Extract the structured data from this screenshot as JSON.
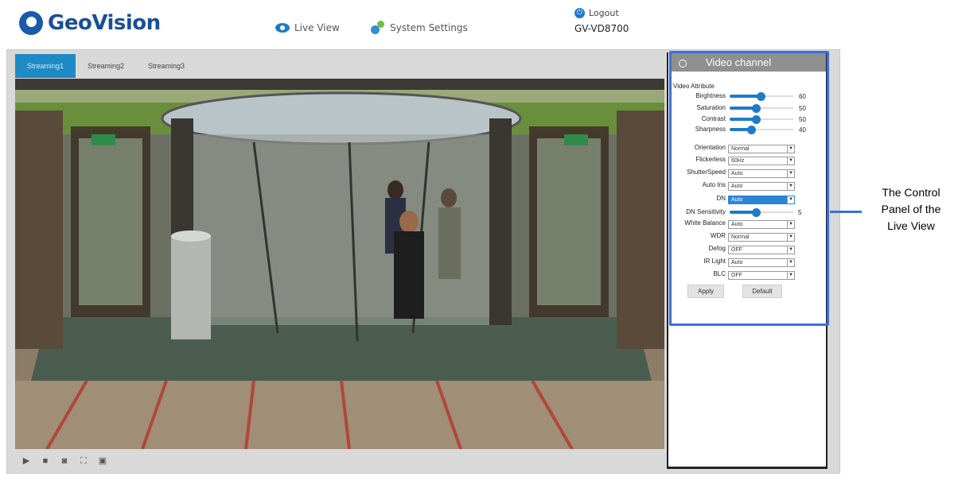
{
  "header": {
    "brand": "GeoVision",
    "nav_live_view": "Live View",
    "nav_system_settings": "System Settings",
    "logout": "Logout",
    "device_name": "GV-VD8700"
  },
  "tabs": [
    "Streaming1",
    "Streaming2",
    "Streaming3"
  ],
  "player_controls": [
    "play-icon",
    "stop-icon",
    "snapshot-icon",
    "fullscreen-icon",
    "record-icon"
  ],
  "panel": {
    "title": "Video channel",
    "attr_title": "Video Attribute",
    "sliders": [
      {
        "label": "Birghtness",
        "value": 60
      },
      {
        "label": "Saturation",
        "value": 50
      },
      {
        "label": "Contrast",
        "value": 50
      },
      {
        "label": "Sharpness",
        "value": 40
      }
    ],
    "selects": [
      {
        "label": "Orientation",
        "value": "Normal"
      },
      {
        "label": "Flickerless",
        "value": "60Hz"
      },
      {
        "label": "ShutterSpeed",
        "value": "Auto"
      },
      {
        "label": "Auto Iris",
        "value": "Auto"
      },
      {
        "label": "DN",
        "value": "Auto"
      }
    ],
    "dn_sensitivity": {
      "label": "DN Sensitivity",
      "value": 5
    },
    "selects2": [
      {
        "label": "White Balance",
        "value": "Auto"
      },
      {
        "label": "WDR",
        "value": "Normal"
      },
      {
        "label": "Defog",
        "value": "OFF"
      },
      {
        "label": "IR Light",
        "value": "Auto"
      },
      {
        "label": "BLC",
        "value": "OFF"
      }
    ],
    "apply": "Apply",
    "default": "Default"
  },
  "annotation": {
    "line1": "The Control",
    "line2": "Panel of the",
    "line3": "Live View"
  },
  "colors": {
    "accent": "#1f8bc4",
    "highlight_box": "#3b6fe0",
    "brand": "#1a4f96"
  }
}
